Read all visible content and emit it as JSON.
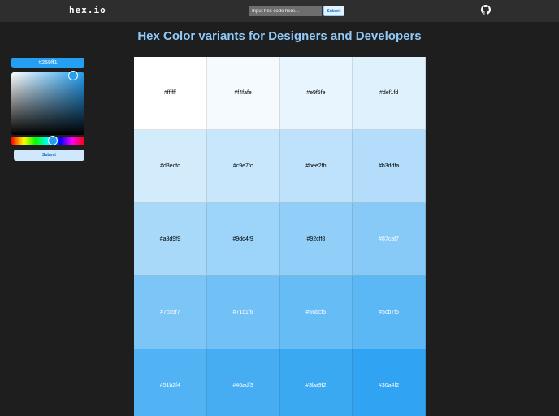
{
  "header": {
    "logo": "hex.io",
    "search_placeholder": "Input hex code here...",
    "search_value": "",
    "submit_label": "Submit",
    "github_icon": "github-icon"
  },
  "title": "Hex Color variants for Designers and Developers",
  "picker": {
    "hex_value": "#259ff1",
    "submit_label": "Submit",
    "selected_color": "#259ff1"
  },
  "swatches": [
    {
      "hex": "#ffffff",
      "text_color": "#000000"
    },
    {
      "hex": "#f4fafe",
      "text_color": "#000000"
    },
    {
      "hex": "#e9f5fe",
      "text_color": "#000000"
    },
    {
      "hex": "#def1fd",
      "text_color": "#000000"
    },
    {
      "hex": "#d3ecfc",
      "text_color": "#000000"
    },
    {
      "hex": "#c9e7fc",
      "text_color": "#000000"
    },
    {
      "hex": "#bee2fb",
      "text_color": "#000000"
    },
    {
      "hex": "#b3ddfa",
      "text_color": "#000000"
    },
    {
      "hex": "#a8d9f9",
      "text_color": "#000000"
    },
    {
      "hex": "#9dd4f9",
      "text_color": "#000000"
    },
    {
      "hex": "#92cff8",
      "text_color": "#000000"
    },
    {
      "hex": "#87caf7",
      "text_color": "#ffffff"
    },
    {
      "hex": "#7cc5f7",
      "text_color": "#ffffff"
    },
    {
      "hex": "#71c1f6",
      "text_color": "#ffffff"
    },
    {
      "hex": "#66bcf5",
      "text_color": "#ffffff"
    },
    {
      "hex": "#5cb7f5",
      "text_color": "#ffffff"
    },
    {
      "hex": "#51b2f4",
      "text_color": "#ffffff"
    },
    {
      "hex": "#46adf3",
      "text_color": "#ffffff"
    },
    {
      "hex": "#3ba9f2",
      "text_color": "#ffffff"
    },
    {
      "hex": "#30a4f2",
      "text_color": "#ffffff"
    }
  ]
}
